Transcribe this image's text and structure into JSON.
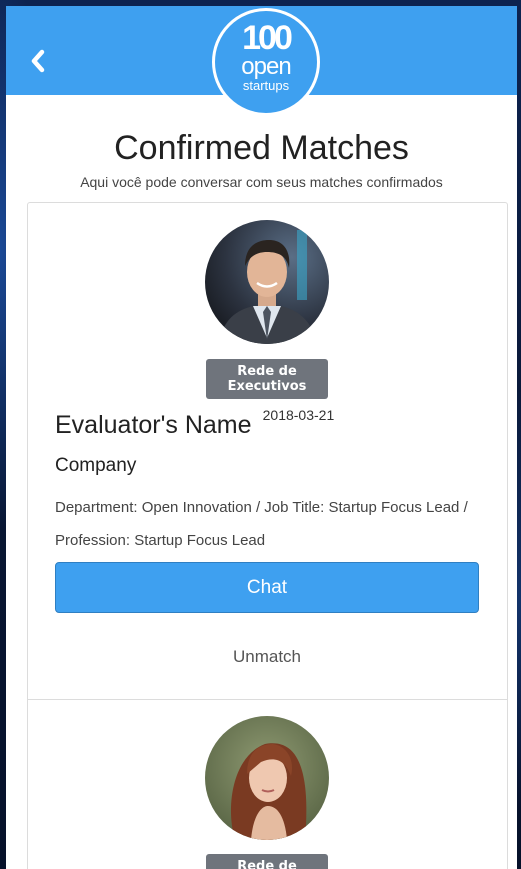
{
  "header": {
    "back_icon": "chevron-left-icon",
    "logo": {
      "line1": "100",
      "line2": "open",
      "line3": "startups"
    },
    "color": "#3ea0f0"
  },
  "page": {
    "title": "Confirmed Matches",
    "subtitle": "Aqui você pode conversar com seus matches confirmados"
  },
  "matches": [
    {
      "avatar_icon": "profile-photo-man",
      "badge_line1": "Rede de",
      "badge_line2": "Executivos",
      "name": "Evaluator's Name",
      "date": "2018-03-21",
      "company": "Company",
      "details": "Department: Open Innovation / Job Title: Startup Focus Lead / Profession: Startup Focus Lead",
      "chat_label": "Chat",
      "unmatch_label": "Unmatch"
    },
    {
      "avatar_icon": "profile-photo-woman",
      "badge_line1": "Rede de"
    }
  ],
  "colors": {
    "accent": "#3ea0f0",
    "badge": "#6f747c",
    "background": "#0b1a36"
  }
}
